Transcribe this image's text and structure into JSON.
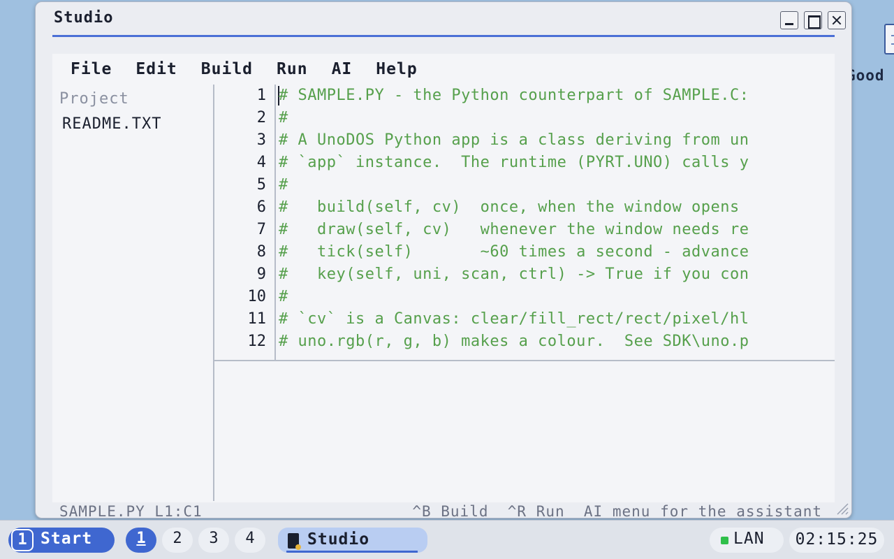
{
  "desktop": {
    "icon_label": "Good",
    "icon_name": "document-icon"
  },
  "window": {
    "title": "Studio",
    "buttons": {
      "minimize": "minimize-icon",
      "maximize": "maximize-icon",
      "close": "close-icon"
    }
  },
  "menubar": {
    "items": [
      "File",
      "Edit",
      "Build",
      "Run",
      "AI",
      "Help"
    ]
  },
  "sidebar": {
    "heading": "Project",
    "files": [
      "README.TXT"
    ]
  },
  "editor": {
    "line_numbers": [
      "1",
      "2",
      "3",
      "4",
      "5",
      "6",
      "7",
      "8",
      "9",
      "10",
      "11",
      "12"
    ],
    "lines": [
      "# SAMPLE.PY - the Python counterpart of SAMPLE.C:",
      "#",
      "# A UnoDOS Python app is a class deriving from un",
      "# `app` instance.  The runtime (PYRT.UNO) calls y",
      "#",
      "#   build(self, cv)  once, when the window opens",
      "#   draw(self, cv)   whenever the window needs re",
      "#   tick(self)       ~60 times a second - advance",
      "#   key(self, uni, scan, ctrl) -> True if you con",
      "#",
      "# `cv` is a Canvas: clear/fill_rect/rect/pixel/hl",
      "# uno.rgb(r, g, b) makes a colour.  See SDK\\uno.p"
    ],
    "comment_color": "#56a04c"
  },
  "statusbar": {
    "position": "SAMPLE.PY L1:C1",
    "hints": "^B Build  ^R Run  AI menu for the assistant"
  },
  "taskbar": {
    "start_number": "1",
    "start_label": "Start",
    "workspaces": [
      "1",
      "2",
      "3",
      "4"
    ],
    "active_workspace": "1",
    "task_label": "Studio",
    "network_label": "LAN",
    "clock": "02:15:25",
    "accent": "#3f67d0"
  }
}
